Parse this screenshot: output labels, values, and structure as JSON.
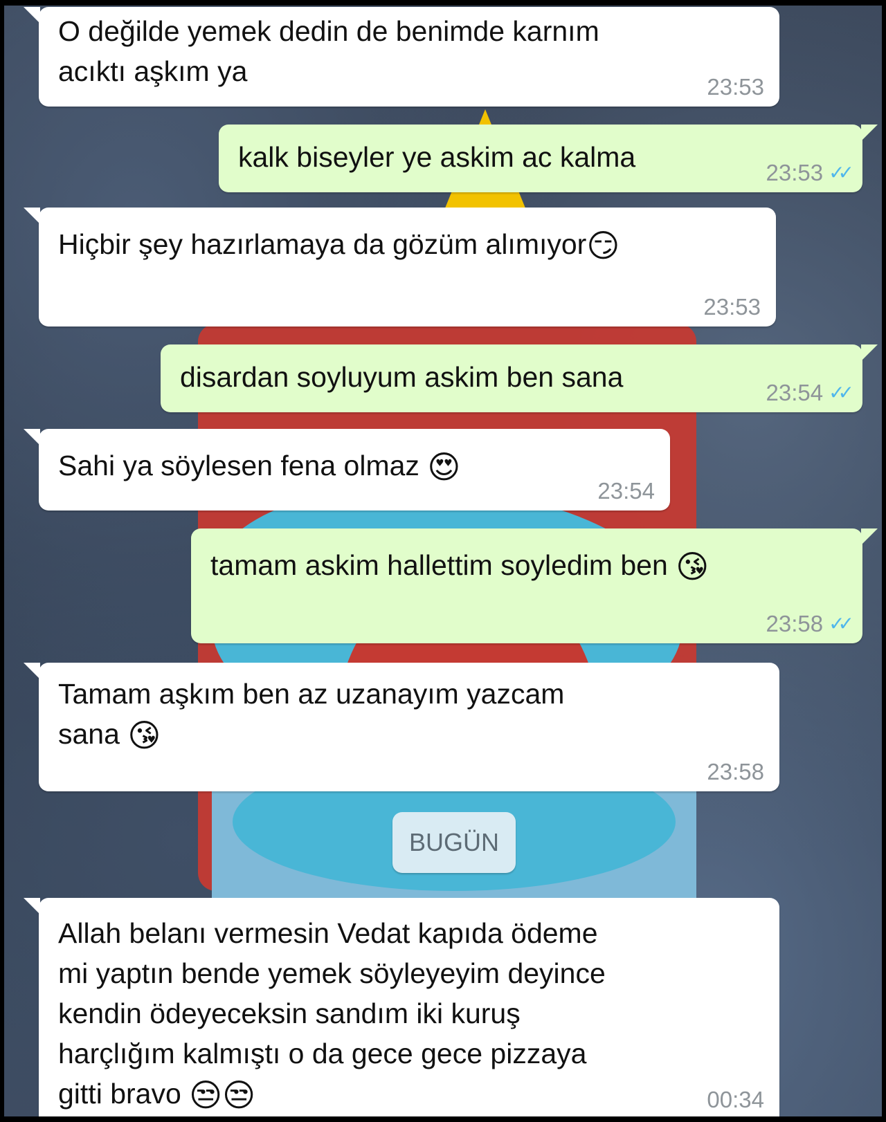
{
  "messages": [
    {
      "direction": "in",
      "text": "O değilde yemek dedin de benimde karnım\nacıktı aşkım ya",
      "time": "23:53"
    },
    {
      "direction": "out",
      "text": "kalk biseyler ye askim ac kalma",
      "time": "23:53",
      "read": true
    },
    {
      "direction": "in",
      "text": "Hiçbir şey hazırlamaya da gözüm alımıyor",
      "emoji": "😏",
      "time": "23:53"
    },
    {
      "direction": "out",
      "text": "disardan soyluyum askim ben sana",
      "time": "23:54",
      "read": true
    },
    {
      "direction": "in",
      "text": "Sahi ya söylesen fena olmaz",
      "emoji": "😍",
      "time": "23:54"
    },
    {
      "direction": "out",
      "text": "tamam askim hallettim soyledim ben",
      "emoji": "😘",
      "time": "23:58",
      "read": true
    },
    {
      "direction": "in",
      "text": "Tamam aşkım ben az uzanayım yazcam\nsana",
      "emoji": "😘",
      "time": "23:58"
    },
    {
      "direction": "in",
      "text": "Allah belanı vermesin Vedat kapıda ödeme\nmi yaptın bende yemek söyleyeyim deyince\nkendin ödeyeceksin sandım iki kuruş\nharçlığım kalmıştı o da gece gece pizzaya\ngitti bravo",
      "emoji": "😒😒",
      "time": "00:34"
    }
  ],
  "date_separator": "BUGÜN",
  "colors": {
    "incoming_bubble": "#ffffff",
    "outgoing_bubble": "#e1fdcb",
    "read_ticks": "#4fb6ec",
    "timestamp": "#8e9499",
    "date_chip": "#d9ebf3"
  },
  "icons": {
    "read_receipt": "double-check-icon"
  }
}
